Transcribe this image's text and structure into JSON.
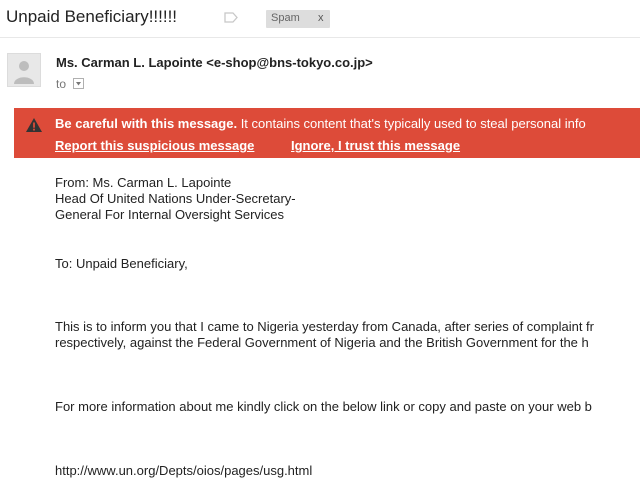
{
  "subject": "Unpaid Beneficiary!!!!!!",
  "labels": {
    "spam": "Spam",
    "remove": "x"
  },
  "sender": {
    "display": "Ms. Carman L. Lapointe <e-shop@bns-tokyo.co.jp>",
    "to_label": "to"
  },
  "warning": {
    "bold": "Be careful with this message.",
    "text": " It contains content that's typically used to steal personal info",
    "report_link": "Report this suspicious message",
    "ignore_link": "Ignore, I trust this message"
  },
  "message": {
    "from_line": "From: Ms. Carman L. Lapointe",
    "title_line_1": "Head Of United Nations Under-Secretary-",
    "title_line_2": "General For Internal Oversight Services",
    "to_line": "To: Unpaid Beneficiary,",
    "para1_line1": "This is to inform you that I came to Nigeria yesterday from Canada, after series of complaint fr",
    "para1_line2": "respectively, against the Federal Government of Nigeria and the British Government for the h",
    "para2": "For more information about me kindly click on the below link or copy and paste on your web b",
    "url": "http://www.un.org/Depts/oios/pages/usg.html"
  },
  "colors": {
    "warning_bg": "#dd4b39",
    "chip_bg": "#dddddd"
  },
  "icons": [
    "label-tag-icon",
    "avatar-person-icon",
    "dropdown-arrow-icon",
    "warning-triangle-icon"
  ]
}
